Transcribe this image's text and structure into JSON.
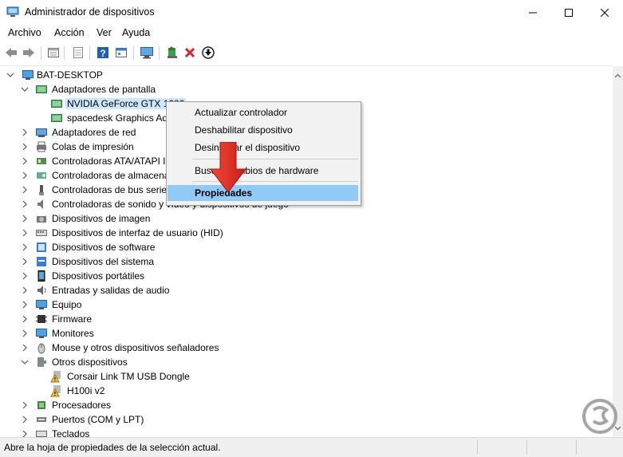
{
  "window": {
    "title": "Administrador de dispositivos"
  },
  "menu": [
    "Archivo",
    "Acción",
    "Ver",
    "Ayuda"
  ],
  "toolbar": {
    "icons": [
      "back-icon",
      "forward-icon",
      "properties-sheet-icon",
      "properties-grid-icon",
      "help-icon",
      "view-icon",
      "monitor-scan-icon",
      "update-driver-icon",
      "uninstall-icon",
      "disable-icon"
    ]
  },
  "tree": {
    "root": "BAT-DESKTOP",
    "items": [
      {
        "label": "Adaptadores de pantalla",
        "level": 1,
        "expanded": true,
        "icon": "display-adapter-icon"
      },
      {
        "label": "NVIDIA GeForce GTX 1080",
        "level": 2,
        "selected": true,
        "icon": "display-adapter-icon"
      },
      {
        "label": "spacedesk Graphics Adapter",
        "level": 2,
        "icon": "display-adapter-icon"
      },
      {
        "label": "Adaptadores de red",
        "level": 1,
        "icon": "network-icon"
      },
      {
        "label": "Colas de impresión",
        "level": 1,
        "icon": "printer-icon"
      },
      {
        "label": "Controladoras ATA/ATAPI IDE",
        "level": 1,
        "icon": "controller-icon"
      },
      {
        "label": "Controladoras de almacenamiento",
        "level": 1,
        "icon": "storage-icon"
      },
      {
        "label": "Controladoras de bus serie universal",
        "level": 1,
        "icon": "usb-icon"
      },
      {
        "label": "Controladoras de sonido y vídeo y dispositivos de juego",
        "level": 1,
        "icon": "sound-icon"
      },
      {
        "label": "Dispositivos de imagen",
        "level": 1,
        "icon": "camera-icon"
      },
      {
        "label": "Dispositivos de interfaz de usuario (HID)",
        "level": 1,
        "icon": "hid-icon"
      },
      {
        "label": "Dispositivos de software",
        "level": 1,
        "icon": "software-icon"
      },
      {
        "label": "Dispositivos del sistema",
        "level": 1,
        "icon": "system-icon"
      },
      {
        "label": "Dispositivos portátiles",
        "level": 1,
        "icon": "portable-icon"
      },
      {
        "label": "Entradas y salidas de audio",
        "level": 1,
        "icon": "audio-icon"
      },
      {
        "label": "Equipo",
        "level": 1,
        "icon": "computer-icon"
      },
      {
        "label": "Firmware",
        "level": 1,
        "icon": "firmware-icon"
      },
      {
        "label": "Monitores",
        "level": 1,
        "icon": "monitor-icon"
      },
      {
        "label": "Mouse y otros dispositivos señaladores",
        "level": 1,
        "icon": "mouse-icon"
      },
      {
        "label": "Otros dispositivos",
        "level": 1,
        "expanded": true,
        "icon": "other-devices-icon"
      },
      {
        "label": "Corsair Link TM USB Dongle",
        "level": 2,
        "icon": "warning-device-icon"
      },
      {
        "label": "H100i v2",
        "level": 2,
        "icon": "warning-device-icon"
      },
      {
        "label": "Procesadores",
        "level": 1,
        "icon": "processor-icon"
      },
      {
        "label": "Puertos (COM y LPT)",
        "level": 1,
        "icon": "port-icon"
      },
      {
        "label": "Teclados",
        "level": 1,
        "icon": "keyboard-icon"
      }
    ]
  },
  "context_menu": {
    "items": [
      "Actualizar controlador",
      "Deshabilitar dispositivo",
      "Desinstalar el dispositivo",
      "Buscar cambios de hardware",
      "Propiedades"
    ],
    "highlighted": "Propiedades"
  },
  "statusbar": {
    "text": "Abre la hoja de propiedades de la selección actual."
  },
  "watermark": {
    "text": "SOLVETIC"
  },
  "colors": {
    "selection": "#cce8ff",
    "menu_highlight": "#91c9f7",
    "arrow": "#e8332a"
  }
}
